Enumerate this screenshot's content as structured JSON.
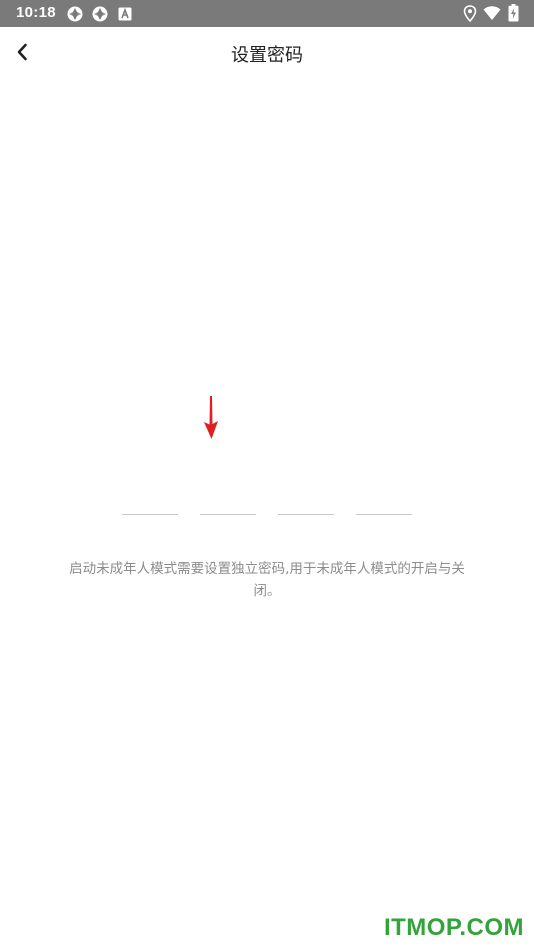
{
  "status_bar": {
    "time": "10:18",
    "left_icons": [
      "app-notification-icon",
      "app-notification-icon",
      "a-icon"
    ],
    "right_icons": [
      "location-icon",
      "wifi-icon",
      "battery-charging-icon"
    ]
  },
  "header": {
    "title": "设置密码",
    "back_icon": "chevron-left-icon"
  },
  "pin": {
    "slots": 4
  },
  "hint": {
    "text": "启动未成年人模式需要设置独立密码,用于未成年人模式的开启与关闭。"
  },
  "watermark": {
    "text": "ITMOP.COM"
  },
  "colors": {
    "status_bar": "#7a7a7a",
    "arrow": "#e02020",
    "watermark": "#35a33b",
    "hint_text": "#8c8c8c"
  }
}
